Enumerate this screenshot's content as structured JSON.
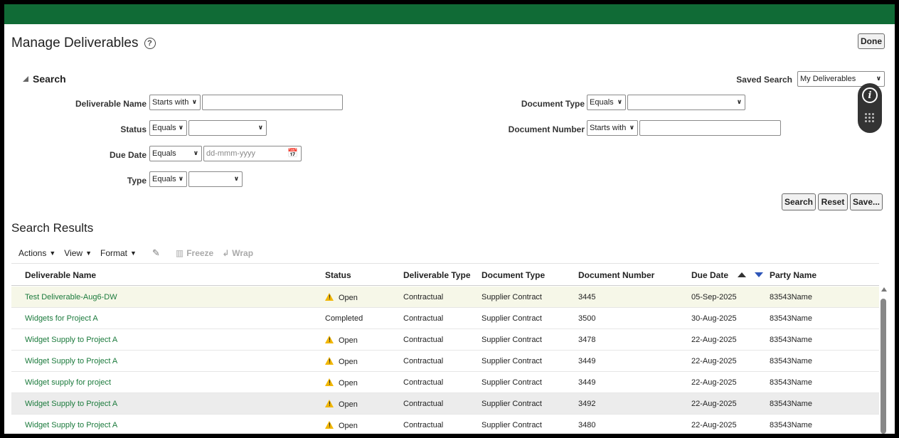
{
  "page": {
    "title": "Manage Deliverables",
    "help_icon": "?",
    "done_label": "Done"
  },
  "search": {
    "heading": "Search",
    "saved_search_label": "Saved Search",
    "saved_search_value": "My Deliverables",
    "fields": {
      "deliverable_name": {
        "label": "Deliverable Name",
        "operator": "Starts with",
        "value": ""
      },
      "status": {
        "label": "Status",
        "operator": "Equals",
        "value": ""
      },
      "due_date": {
        "label": "Due Date",
        "operator": "Equals",
        "placeholder": "dd-mmm-yyyy"
      },
      "type": {
        "label": "Type",
        "operator": "Equals",
        "value": ""
      },
      "document_type": {
        "label": "Document Type",
        "operator": "Equals",
        "value": ""
      },
      "document_number": {
        "label": "Document Number",
        "operator": "Starts with",
        "value": ""
      }
    },
    "buttons": {
      "search": "Search",
      "reset": "Reset",
      "save": "Save..."
    }
  },
  "results": {
    "title": "Search Results",
    "toolbar": {
      "actions": "Actions",
      "view": "View",
      "format": "Format",
      "freeze": "Freeze",
      "wrap": "Wrap"
    },
    "columns": [
      "Deliverable Name",
      "Status",
      "Deliverable Type",
      "Document Type",
      "Document Number",
      "Due Date",
      "Party Name"
    ],
    "rows": [
      {
        "name": "Test Deliverable-Aug6-DW",
        "status": "Open",
        "warn": true,
        "dtype": "Contractual",
        "doctype": "Supplier Contract",
        "docnum": "3445",
        "due": "05-Sep-2025",
        "party": "83543Name"
      },
      {
        "name": "Widgets for Project A",
        "status": "Completed",
        "warn": false,
        "dtype": "Contractual",
        "doctype": "Supplier Contract",
        "docnum": "3500",
        "due": "30-Aug-2025",
        "party": "83543Name"
      },
      {
        "name": "Widget Supply to Project A",
        "status": "Open",
        "warn": true,
        "dtype": "Contractual",
        "doctype": "Supplier Contract",
        "docnum": "3478",
        "due": "22-Aug-2025",
        "party": "83543Name"
      },
      {
        "name": "Widget Supply to Project A",
        "status": "Open",
        "warn": true,
        "dtype": "Contractual",
        "doctype": "Supplier Contract",
        "docnum": "3449",
        "due": "22-Aug-2025",
        "party": "83543Name"
      },
      {
        "name": "Widget supply for project",
        "status": "Open",
        "warn": true,
        "dtype": "Contractual",
        "doctype": "Supplier Contract",
        "docnum": "3449",
        "due": "22-Aug-2025",
        "party": "83543Name"
      },
      {
        "name": "Widget Supply to Project A",
        "status": "Open",
        "warn": true,
        "dtype": "Contractual",
        "doctype": "Supplier Contract",
        "docnum": "3492",
        "due": "22-Aug-2025",
        "party": "83543Name"
      },
      {
        "name": "Widget Supply to Project A",
        "status": "Open",
        "warn": true,
        "dtype": "Contractual",
        "doctype": "Supplier Contract",
        "docnum": "3480",
        "due": "22-Aug-2025",
        "party": "83543Name"
      }
    ],
    "selected_row": 0,
    "hover_row": 5
  },
  "colors": {
    "brand_green": "#106b36",
    "link_green": "#1b7a3c",
    "selected_row_bg": "#f6f7e8",
    "hover_row_bg": "#ececec",
    "warning_yellow": "#f2b705",
    "sort_blue": "#2d55b8"
  },
  "icons": {
    "help": "help-circle-icon",
    "warning": "warning-triangle-icon",
    "calendar": "calendar-icon",
    "info": "info-icon",
    "edit": "pencil-icon",
    "freeze": "freeze-icon",
    "wrap": "wrap-icon"
  }
}
